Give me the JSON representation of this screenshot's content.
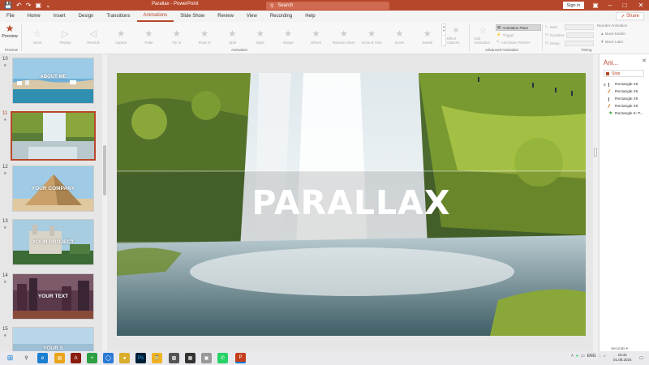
{
  "titlebar": {
    "doc_title": "Parallax  -  PowerPoint",
    "search_placeholder": "Search",
    "signin_label": "Sign in"
  },
  "tabs": [
    "File",
    "Home",
    "Insert",
    "Design",
    "Transitions",
    "Animations",
    "Slide Show",
    "Review",
    "View",
    "Recording",
    "Help"
  ],
  "active_tab": "Animations",
  "share_label": "Share",
  "ribbon": {
    "preview_label": "Preview",
    "preview_group": "Preview",
    "animation_group": "Animation",
    "advanced_group": "Advanced Animation",
    "timing_group": "Timing",
    "animations": [
      "None",
      "Appear",
      "Fade",
      "Fly In",
      "Float In",
      "Split",
      "Wipe",
      "Shape",
      "Wheel",
      "Random Bars",
      "Grow & Turn",
      "Zoom",
      "Swivel"
    ],
    "animations_visible": [
      "None",
      "Fly In",
      "Fade",
      "Fly In",
      "Fade",
      "Fly In",
      "Float In",
      "Split",
      "Wipe",
      "Shape",
      "Wheel",
      "Random Bars",
      "Grow & Turn",
      "Zoom",
      "Swivel"
    ],
    "effect_options": "Effect Options",
    "add_animation": "Add Animation",
    "animation_pane": "Animation Pane",
    "trigger": "Trigger",
    "animation_painter": "Animation Painter",
    "start": "Start:",
    "duration": "Duration:",
    "delay": "Delay:",
    "reorder": "Reorder Animation",
    "move_earlier": "Move Earlier",
    "move_later": "Move Later"
  },
  "slides": [
    {
      "num": "10",
      "label": "ABOUT ME"
    },
    {
      "num": "11",
      "label": ""
    },
    {
      "num": "12",
      "label": "YOUR COMPANY"
    },
    {
      "num": "13",
      "label": "YOUR PROJECT"
    },
    {
      "num": "14",
      "label": "YOUR TEXT"
    },
    {
      "num": "15",
      "label": "YOUR S"
    }
  ],
  "active_slide": "11",
  "slide": {
    "title": "PARALLAX"
  },
  "pane": {
    "title": "Ani...",
    "play_label": "Stop",
    "items": [
      {
        "num": "0",
        "name": "Rectangle 28"
      },
      {
        "num": "",
        "name": "Rectangle 26"
      },
      {
        "num": "",
        "name": "Rectangle 29"
      },
      {
        "num": "",
        "name": "Rectangle 29"
      },
      {
        "num": "",
        "name": "Rectangle 6: P..."
      }
    ],
    "seconds_label": "Seconds"
  },
  "tray": {
    "lang": "ENG",
    "time": "15:41",
    "date": "01.08.2024"
  },
  "colors": {
    "accent": "#b7472a",
    "ribbon_bg": "#f7f7f7",
    "canvas_bg": "#e6e6e6"
  }
}
